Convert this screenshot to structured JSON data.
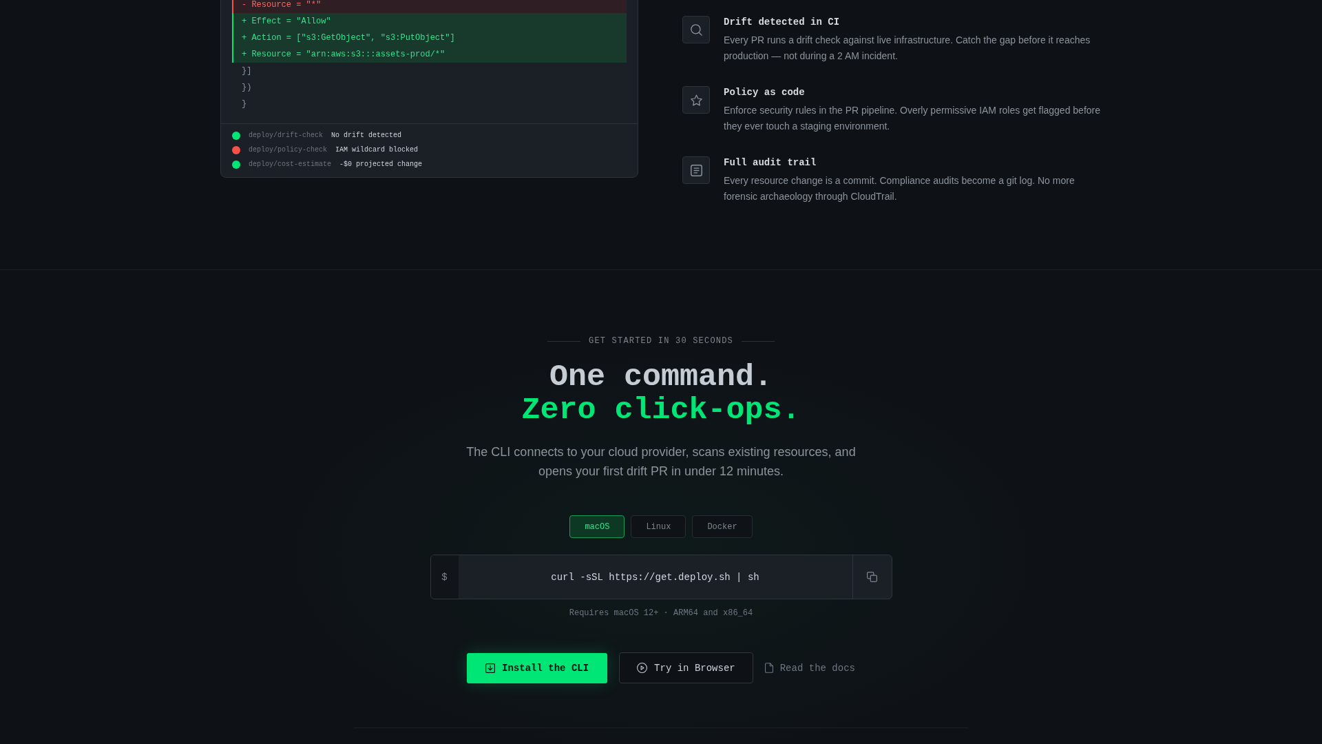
{
  "code_panel": {
    "lines": [
      {
        "kind": "removed",
        "text": "- Resource = \"*\""
      },
      {
        "kind": "added",
        "text": "+ Effect = \"Allow\""
      },
      {
        "kind": "added",
        "text": "+ Action = [\"s3:GetObject\", \"s3:PutObject\"]"
      },
      {
        "kind": "added",
        "text": "+ Resource = \"arn:aws:s3:::assets-prod/*\""
      },
      {
        "kind": "context",
        "text": "}]"
      },
      {
        "kind": "context",
        "text": "})"
      },
      {
        "kind": "context",
        "text": "}"
      }
    ],
    "checks": [
      {
        "name": "deploy/drift-check",
        "result": "No drift detected",
        "color": "#00e676"
      },
      {
        "name": "deploy/policy-check",
        "result": "IAM wildcard blocked",
        "color": "#f85149"
      },
      {
        "name": "deploy/cost-estimate",
        "result": "-$0 projected change",
        "color": "#00e676"
      }
    ]
  },
  "features": [
    {
      "title": "Drift detected in CI",
      "description": "Every PR runs a drift check against live infrastructure. Catch the gap before it reaches production — not during a 2 AM incident."
    },
    {
      "title": "Policy as code",
      "description": "Enforce security rules in the PR pipeline. Overly permissive IAM roles get flagged before they ever touch a staging environment."
    },
    {
      "title": "Full audit trail",
      "description": "Every resource change is a commit. Compliance audits become a git log. No more forensic archaeology through CloudTrail."
    }
  ],
  "get_started": {
    "eyebrow": "GET STARTED IN 30 SECONDS",
    "headline": [
      {
        "kind": "plain",
        "text": "One command."
      },
      {
        "kind": "accent",
        "text": "Zero click-ops."
      }
    ],
    "description": "The CLI connects to your cloud provider, scans existing resources, and opens your first drift PR in under 12 minutes.",
    "tabs": [
      {
        "label": "macOS",
        "selected": true
      },
      {
        "label": "Linux",
        "selected": false
      },
      {
        "label": "Docker",
        "selected": false
      }
    ],
    "command": {
      "prompt": "$",
      "text": "curl -sSL https://get.deploy.sh | sh"
    },
    "requirements": "Requires macOS 12+ · ARM64 and x86_64",
    "actions": [
      {
        "kind": "primary",
        "label": "Install the CLI"
      },
      {
        "kind": "secondary",
        "label": "Try in Browser"
      },
      {
        "kind": "link",
        "label": "Read the docs"
      }
    ]
  }
}
